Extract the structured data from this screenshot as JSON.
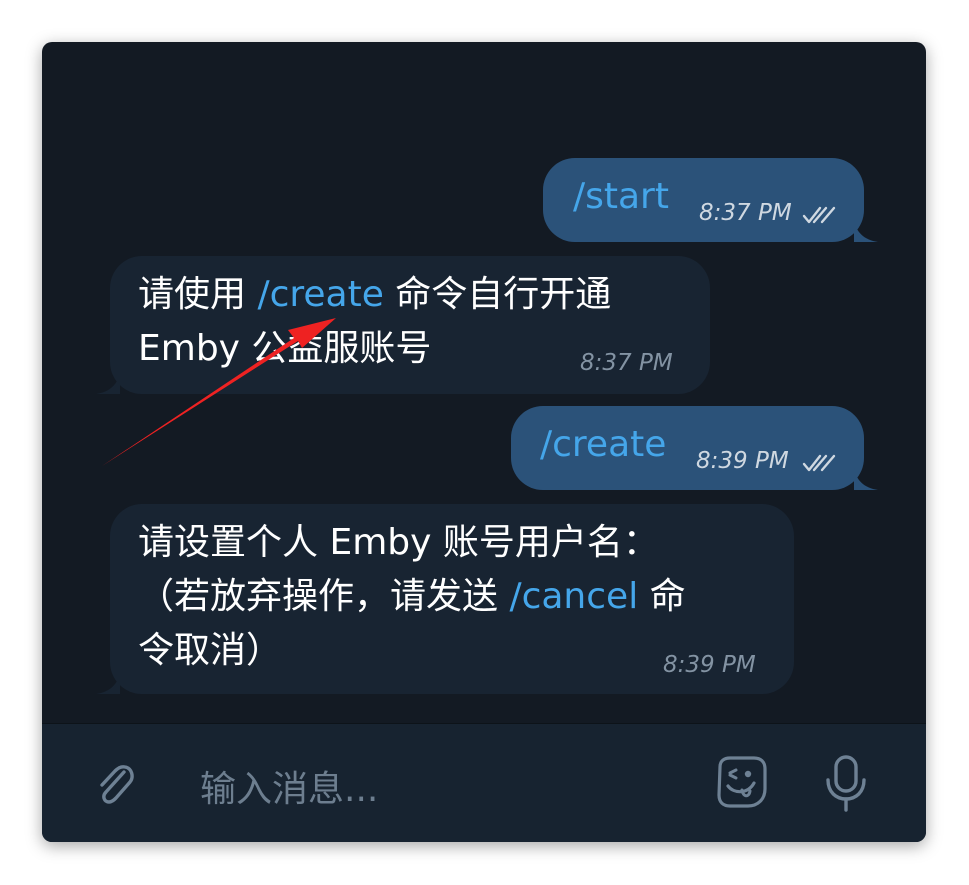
{
  "messages": [
    {
      "dir": "out",
      "text": "/start",
      "time": "8:37 PM",
      "read": true
    },
    {
      "dir": "in",
      "line1_a": "请使用 ",
      "line1_cmd": "/create",
      "line1_b": " 命令自行开通",
      "line2": "Emby 公益服账号",
      "time": "8:37 PM"
    },
    {
      "dir": "out",
      "text": "/create",
      "time": "8:39 PM",
      "read": true
    },
    {
      "dir": "in",
      "line1": "请设置个人 Emby 账号用户名：",
      "line2_a": "（若放弃操作，请发送 ",
      "line2_cmd": "/cancel",
      "line2_b": " 命",
      "line3": "令取消）",
      "time": "8:39 PM"
    }
  ],
  "composer": {
    "placeholder": "输入消息...",
    "icons": [
      "paperclip-icon",
      "sticker-icon",
      "microphone-icon"
    ]
  },
  "annotation": {
    "arrow_color": "#ee2222"
  },
  "colors": {
    "bg": "#131a23",
    "outgoing": "#2b5279",
    "incoming": "#182432",
    "link": "#45a6ea"
  }
}
